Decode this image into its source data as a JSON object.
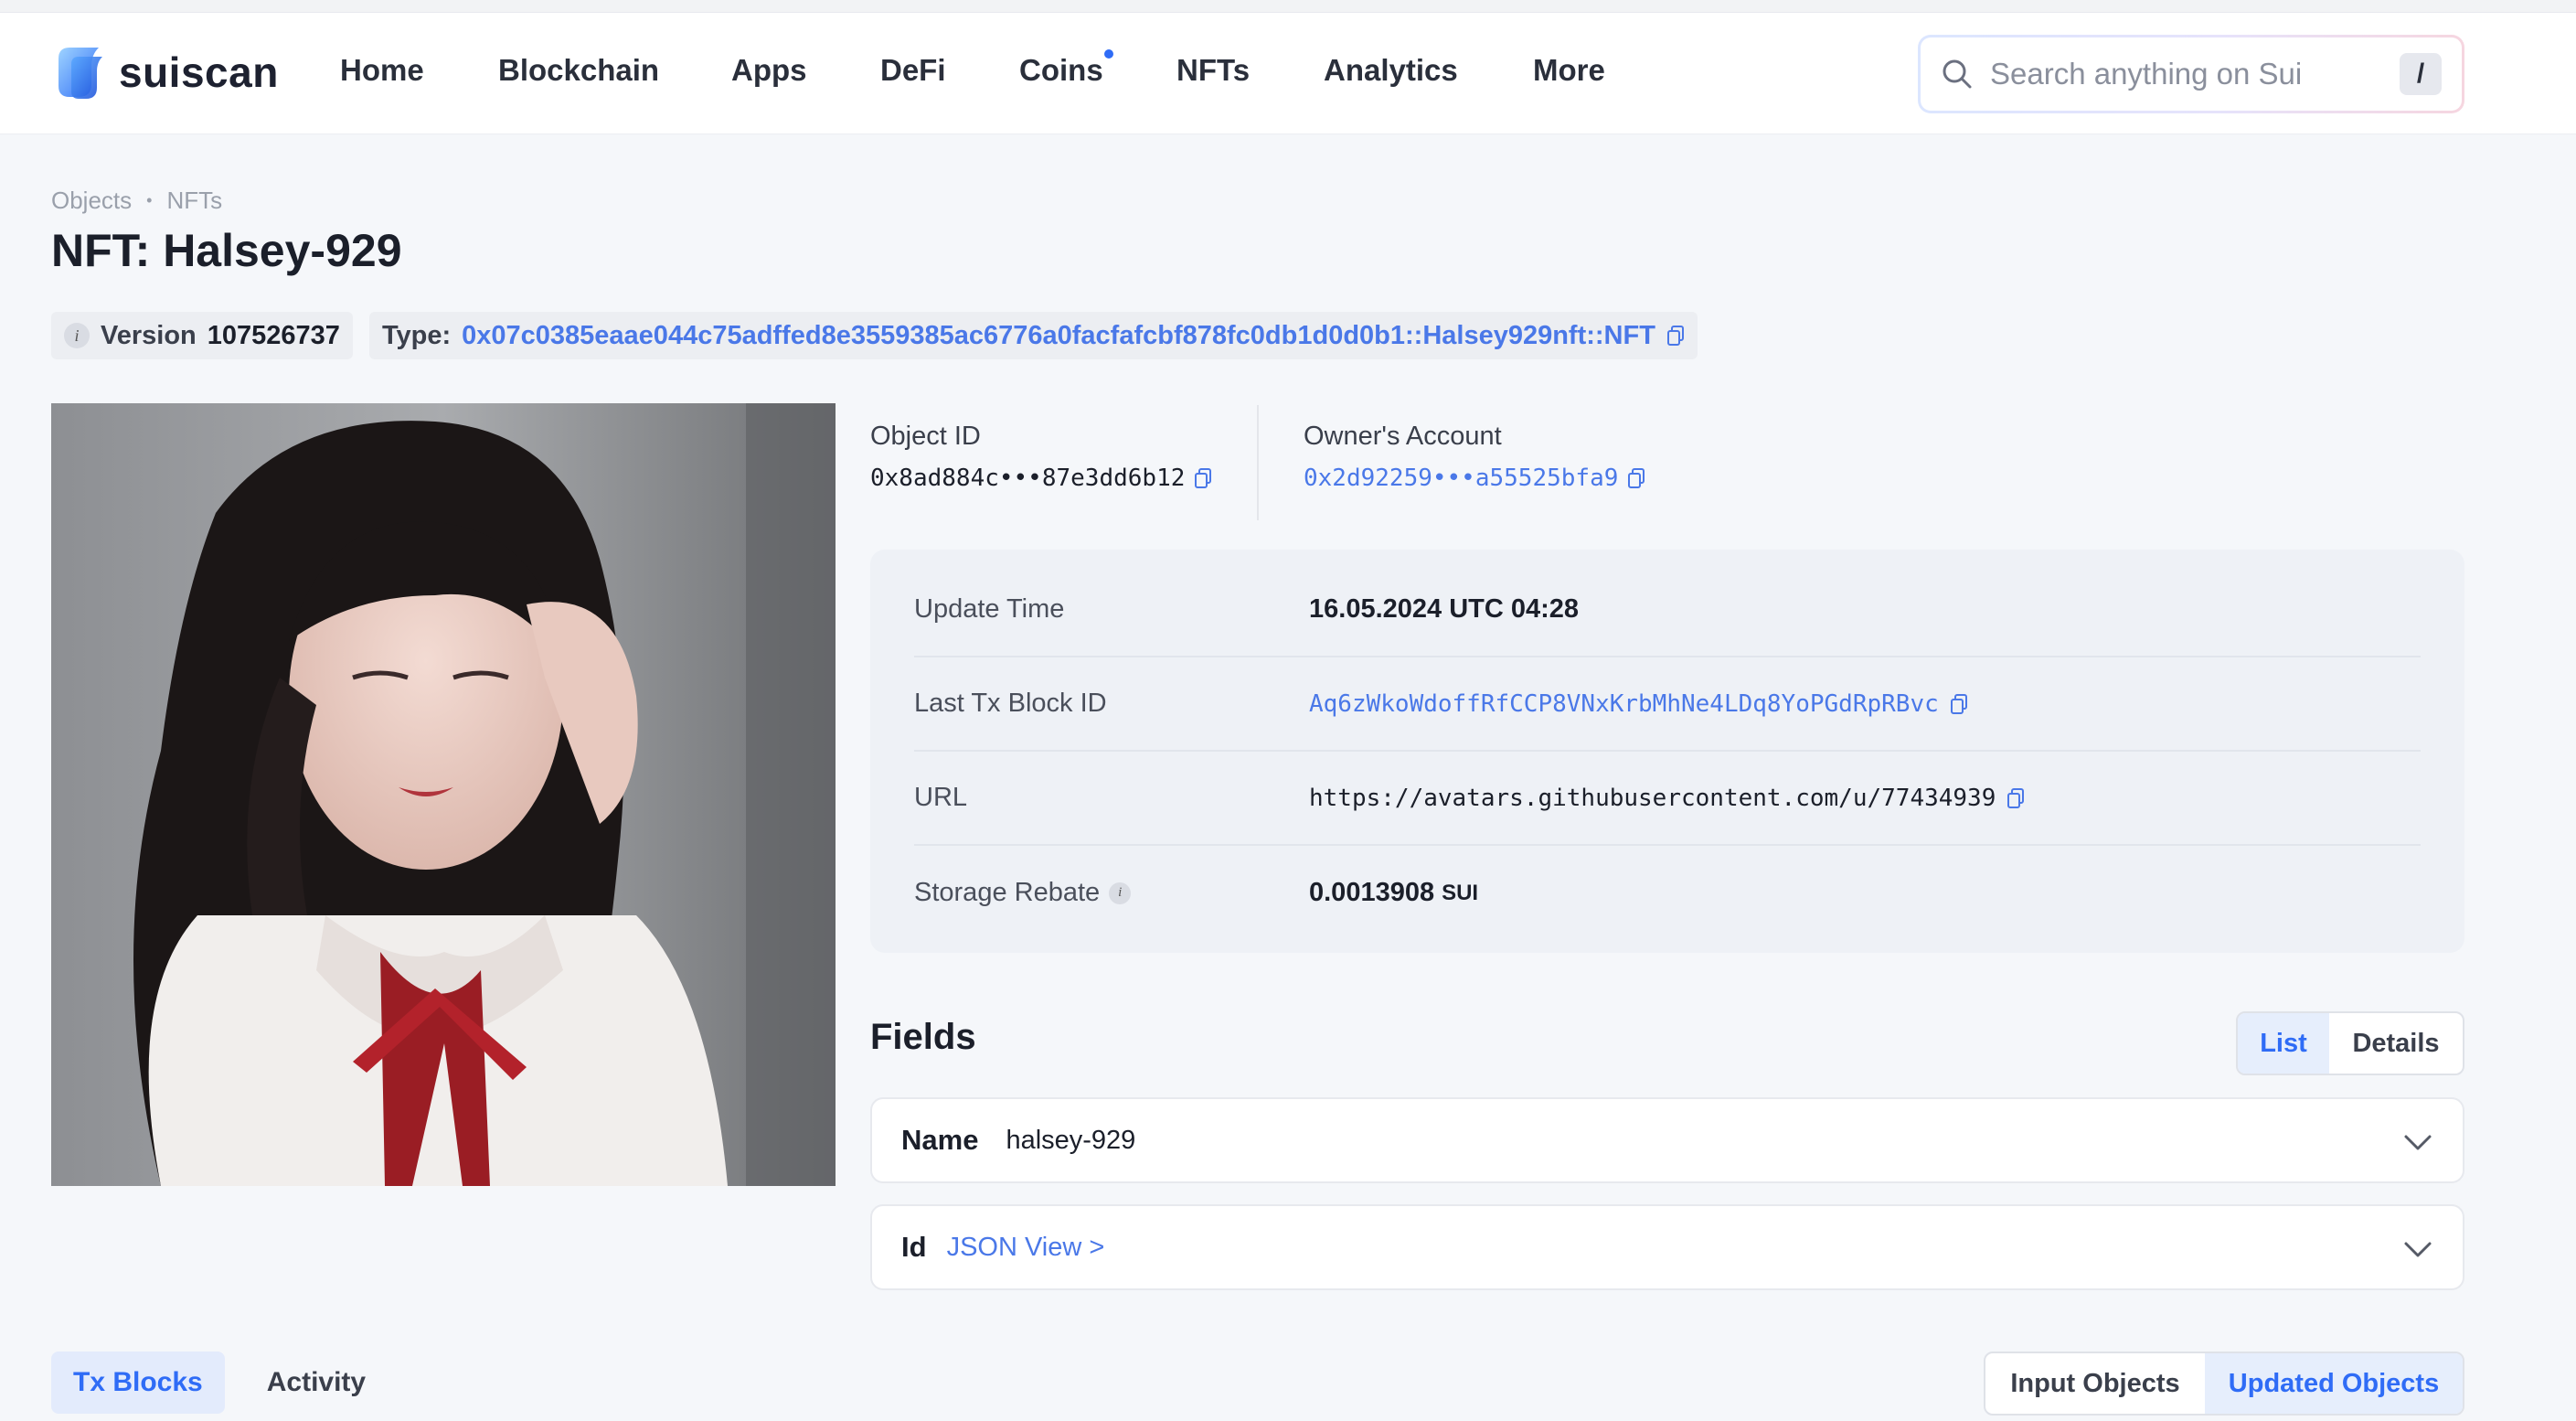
{
  "app": {
    "name": "suiscan"
  },
  "nav": {
    "items": [
      "Home",
      "Blockchain",
      "Apps",
      "DeFi",
      "Coins",
      "NFTs",
      "Analytics",
      "More"
    ]
  },
  "search": {
    "placeholder": "Search anything on Sui",
    "shortcut": "/"
  },
  "breadcrumb": {
    "items": [
      "Objects",
      "NFTs"
    ],
    "separator": "•"
  },
  "page": {
    "title": "NFT: Halsey-929"
  },
  "chips": {
    "version_label": "Version",
    "version_value": "107526737",
    "type_label": "Type:",
    "type_value": "0x07c0385eaae044c75adffed8e3559385ac6776a0facfafcbf878fc0db1d0d0b1::Halsey929nft::NFT"
  },
  "object": {
    "id_label": "Object ID",
    "id_value": "0x8ad884c•••87e3dd6b12",
    "owner_label": "Owner's Account",
    "owner_value": "0x2d92259•••a55525bfa9"
  },
  "properties": {
    "update_time_label": "Update Time",
    "update_time_value": "16.05.2024 UTC 04:28",
    "last_tx_label": "Last Tx Block ID",
    "last_tx_value": "Aq6zWkoWdoffRfCCP8VNxKrbMhNe4LDq8YoPGdRpRBvc",
    "url_label": "URL",
    "url_value": "https://avatars.githubusercontent.com/u/77434939",
    "storage_label": "Storage Rebate",
    "storage_value": "0.0013908",
    "storage_unit": "SUI"
  },
  "fields": {
    "title": "Fields",
    "view_list": "List",
    "view_details": "Details",
    "rows": [
      {
        "name": "Name",
        "value": "halsey-929"
      },
      {
        "name": "Id",
        "value": "JSON View >"
      }
    ]
  },
  "bottom_tabs": {
    "tx_blocks": "Tx Blocks",
    "activity": "Activity"
  },
  "objects_toggle": {
    "input": "Input Objects",
    "updated": "Updated Objects"
  },
  "colors": {
    "accent": "#2f6cf6",
    "link": "#4a78e8",
    "background": "#f5f7fa"
  }
}
